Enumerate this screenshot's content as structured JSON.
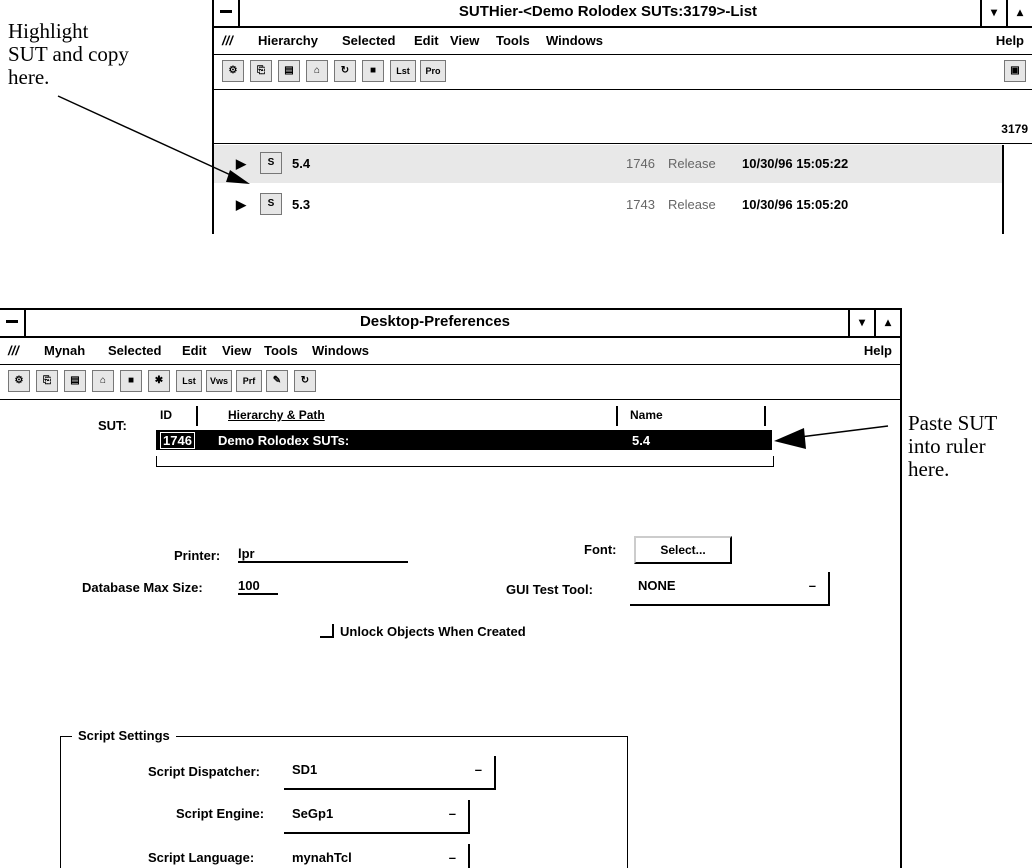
{
  "annotations": {
    "top_left": [
      "Highlight",
      "SUT and copy",
      "here."
    ],
    "right": [
      "Paste SUT",
      "into ruler",
      "here."
    ]
  },
  "hier_window": {
    "title": "SUTHier-<Demo Rolodex SUTs:3179>-List",
    "menu": [
      "Hierarchy",
      "Selected",
      "Edit",
      "View",
      "Tools",
      "Windows"
    ],
    "help": "Help",
    "toolbar_text": [
      "Lst",
      "Pro"
    ],
    "count": "3179",
    "rows": [
      {
        "name": "5.4",
        "id": "1746",
        "status": "Release",
        "date": "10/30/96 15:05:22"
      },
      {
        "name": "5.3",
        "id": "1743",
        "status": "Release",
        "date": "10/30/96 15:05:20"
      }
    ]
  },
  "prefs_window": {
    "title": "Desktop-Preferences",
    "menu": [
      "Mynah",
      "Selected",
      "Edit",
      "View",
      "Tools",
      "Windows"
    ],
    "help": "Help",
    "toolbar_text": [
      "Lst",
      "Vws",
      "Prf"
    ],
    "sut_label": "SUT:",
    "ruler_headers": {
      "id": "ID",
      "path": "Hierarchy & Path",
      "name": "Name"
    },
    "ruler_row": {
      "id": "1746",
      "path": "Demo Rolodex SUTs:",
      "name": "5.4"
    },
    "printer_label": "Printer:",
    "printer_value": "lpr",
    "font_label": "Font:",
    "font_button": "Select...",
    "db_label": "Database Max Size:",
    "db_value": "100",
    "gui_label": "GUI Test Tool:",
    "gui_value": "NONE",
    "unlock_label": "Unlock Objects When Created",
    "script_group": "Script Settings",
    "dispatcher_label": "Script Dispatcher:",
    "dispatcher_value": "SD1",
    "engine_label": "Script Engine:",
    "engine_value": "SeGp1",
    "language_label": "Script Language:",
    "language_value": "mynahTcl"
  }
}
